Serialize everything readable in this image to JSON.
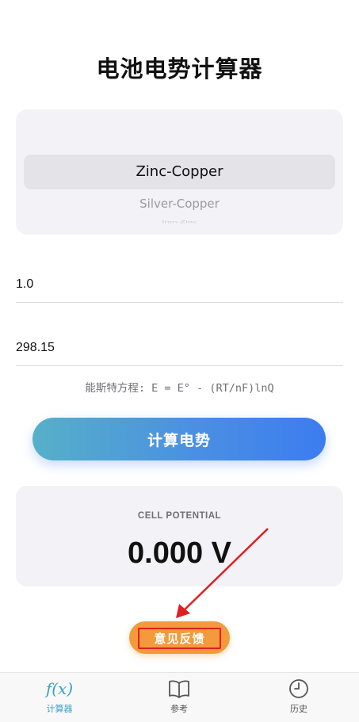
{
  "page": {
    "title": "电池电势计算器"
  },
  "picker": {
    "items": [
      "Zinc-Copper",
      "Silver-Copper",
      "Iron-Zinc"
    ],
    "selected_index": 0
  },
  "inputs": {
    "concentration": "1.0",
    "temperature": "298.15"
  },
  "formula": "能斯特方程: E = E° - (RT/nF)lnQ",
  "calculate_button": "计算电势",
  "result": {
    "label": "CELL POTENTIAL",
    "value": "0.000 V"
  },
  "feedback_button": "意见反馈",
  "tabs": [
    {
      "label": "计算器",
      "icon": "fx-icon",
      "active": true
    },
    {
      "label": "参考",
      "icon": "book-icon",
      "active": false
    },
    {
      "label": "历史",
      "icon": "clock-icon",
      "active": false
    }
  ],
  "colors": {
    "accent": "#3aa0c8",
    "tab_inactive": "#555555",
    "feedback": "#f39a3a",
    "highlight": "#e02020"
  }
}
